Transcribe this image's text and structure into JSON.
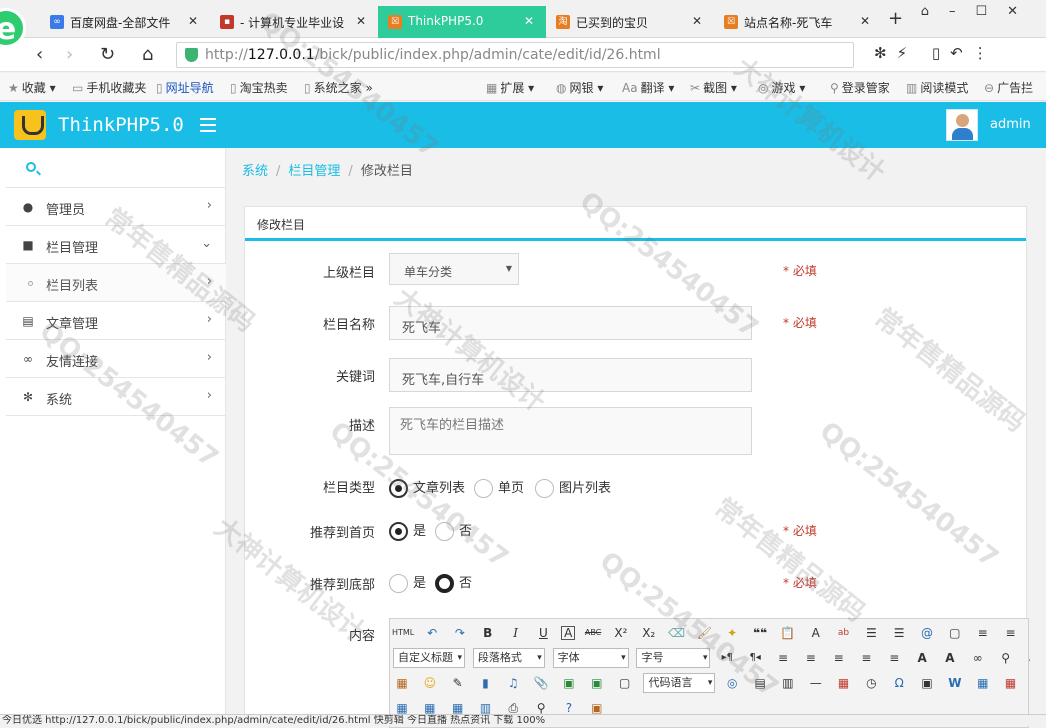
{
  "browser": {
    "tabs": [
      {
        "label": "百度网盘-全部文件",
        "active": false
      },
      {
        "label": "- 计算机专业毕业设",
        "active": false
      },
      {
        "label": "ThinkPHP5.0",
        "active": true
      },
      {
        "label": "已买到的宝贝",
        "active": false
      },
      {
        "label": "站点名称-死飞车",
        "active": false
      }
    ],
    "new_tab": "+",
    "url_prefix": "http://",
    "url_host": "127.0.0.1",
    "url_path": "/bick/public/index.php/admin/cate/edit/id/26.html",
    "bookmarks": [
      "收藏",
      "手机收藏夹",
      "网址导航",
      "淘宝热卖",
      "系统之家",
      "扩展",
      "网银",
      "翻译",
      "截图",
      "游戏",
      "登录管家",
      "阅读模式",
      "广告拦"
    ],
    "status_text": "今日优选   http://127.0.0.1/bick/public/index.php/admin/cate/edit/id/26.html   快剪辑   今日直播   热点资讯     下载     100%"
  },
  "app": {
    "brand": "ThinkPHP5.0",
    "user": "admin"
  },
  "sidebar": {
    "items": [
      {
        "label": "管理员",
        "icon": "user-icon",
        "glyph": "●",
        "chev": "›"
      },
      {
        "label": "栏目管理",
        "icon": "folder-icon",
        "glyph": "■",
        "chev": "⌄"
      },
      {
        "label": "栏目列表",
        "icon": "dot-icon",
        "glyph": "",
        "chev": "›"
      },
      {
        "label": "文章管理",
        "icon": "file-icon",
        "glyph": "▤",
        "chev": "›"
      },
      {
        "label": "友情连接",
        "icon": "link-icon",
        "glyph": "∞",
        "chev": "›"
      },
      {
        "label": "系统",
        "icon": "gear-icon",
        "glyph": "✻",
        "chev": "›"
      }
    ]
  },
  "breadcrumb": {
    "items": [
      "系统",
      "栏目管理",
      "修改栏目"
    ],
    "sep": "/"
  },
  "panel": {
    "title": "修改栏目"
  },
  "form": {
    "parent": {
      "label": "上级栏目",
      "value": "单车分类",
      "required": "* 必填"
    },
    "name": {
      "label": "栏目名称",
      "value": "死飞车",
      "required": "* 必填"
    },
    "keywords": {
      "label": "关键词",
      "value": "死飞车,自行车"
    },
    "desc": {
      "label": "描述",
      "value": "死飞车的栏目描述"
    },
    "type": {
      "label": "栏目类型",
      "options": [
        "文章列表",
        "单页",
        "图片列表"
      ],
      "selected": 0
    },
    "rec_index": {
      "label": "推荐到首页",
      "options": [
        "是",
        "否"
      ],
      "selected": 0,
      "required": "* 必填"
    },
    "rec_bottom": {
      "label": "推荐到底部",
      "options": [
        "是",
        "否"
      ],
      "selected": 1,
      "required": "* 必填"
    },
    "content": {
      "label": "内容"
    }
  },
  "editor": {
    "row1": [
      "HTML",
      "↶",
      "↷",
      "B",
      "I",
      "U",
      "A",
      "ABC",
      "X²",
      "X₂",
      "⌫",
      "🖌",
      "✦",
      "❝❝",
      "📋",
      "A",
      "ab",
      "☰",
      "☰",
      "@",
      "▢",
      "≡",
      "≡"
    ],
    "row2_selects": [
      "自定义标题",
      "段落格式",
      "字体",
      "字号"
    ],
    "row2": [
      "▸¶",
      "¶◂",
      "≡",
      "≡",
      "≡",
      "≡",
      "≡",
      "A",
      "A",
      "∞",
      "⚲",
      "⚓",
      "▦"
    ],
    "row3_select": "代码语言",
    "row3": [
      "▦",
      "☺",
      "✎",
      "▮",
      "♫",
      "📎",
      "▣",
      "▣",
      "▢",
      "◎",
      "▤",
      "▥",
      "—",
      "▦",
      "◷",
      "Ω",
      "▣",
      "W",
      "▦",
      "▦",
      "▥"
    ]
  },
  "watermarks": [
    "QQ:254540457",
    "大神计算机设计",
    "常年售精品源码"
  ]
}
